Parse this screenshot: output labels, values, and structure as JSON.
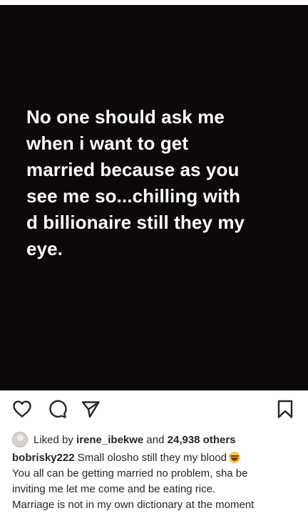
{
  "post": {
    "text_lines": [
      "No one should ask me",
      "when i want to get",
      "married because as you",
      "see me so...chilling with",
      "d billionaire still they my",
      "eye."
    ]
  },
  "actions": {
    "like_icon": "heart-outline-icon",
    "comment_icon": "comment-bubble-icon",
    "share_icon": "paper-plane-icon",
    "save_icon": "bookmark-icon"
  },
  "likes": {
    "prefix": "Liked by ",
    "user": "irene_ibekwe",
    "middle": " and ",
    "count": "24,938 others"
  },
  "caption": {
    "username": "bobrisky222",
    "line1": "Small olosho still they my blood",
    "line1_emoji": "joy-emoji-icon",
    "line2": "You all can be getting married no problem, sha be",
    "line3": "inviting me let me come and be eating rice.",
    "line4": "Marriage is not in my own dictionary at the moment"
  },
  "colors": {
    "post_background": "#0c0908",
    "post_text": "#ffffff",
    "body_text": "#262626"
  }
}
